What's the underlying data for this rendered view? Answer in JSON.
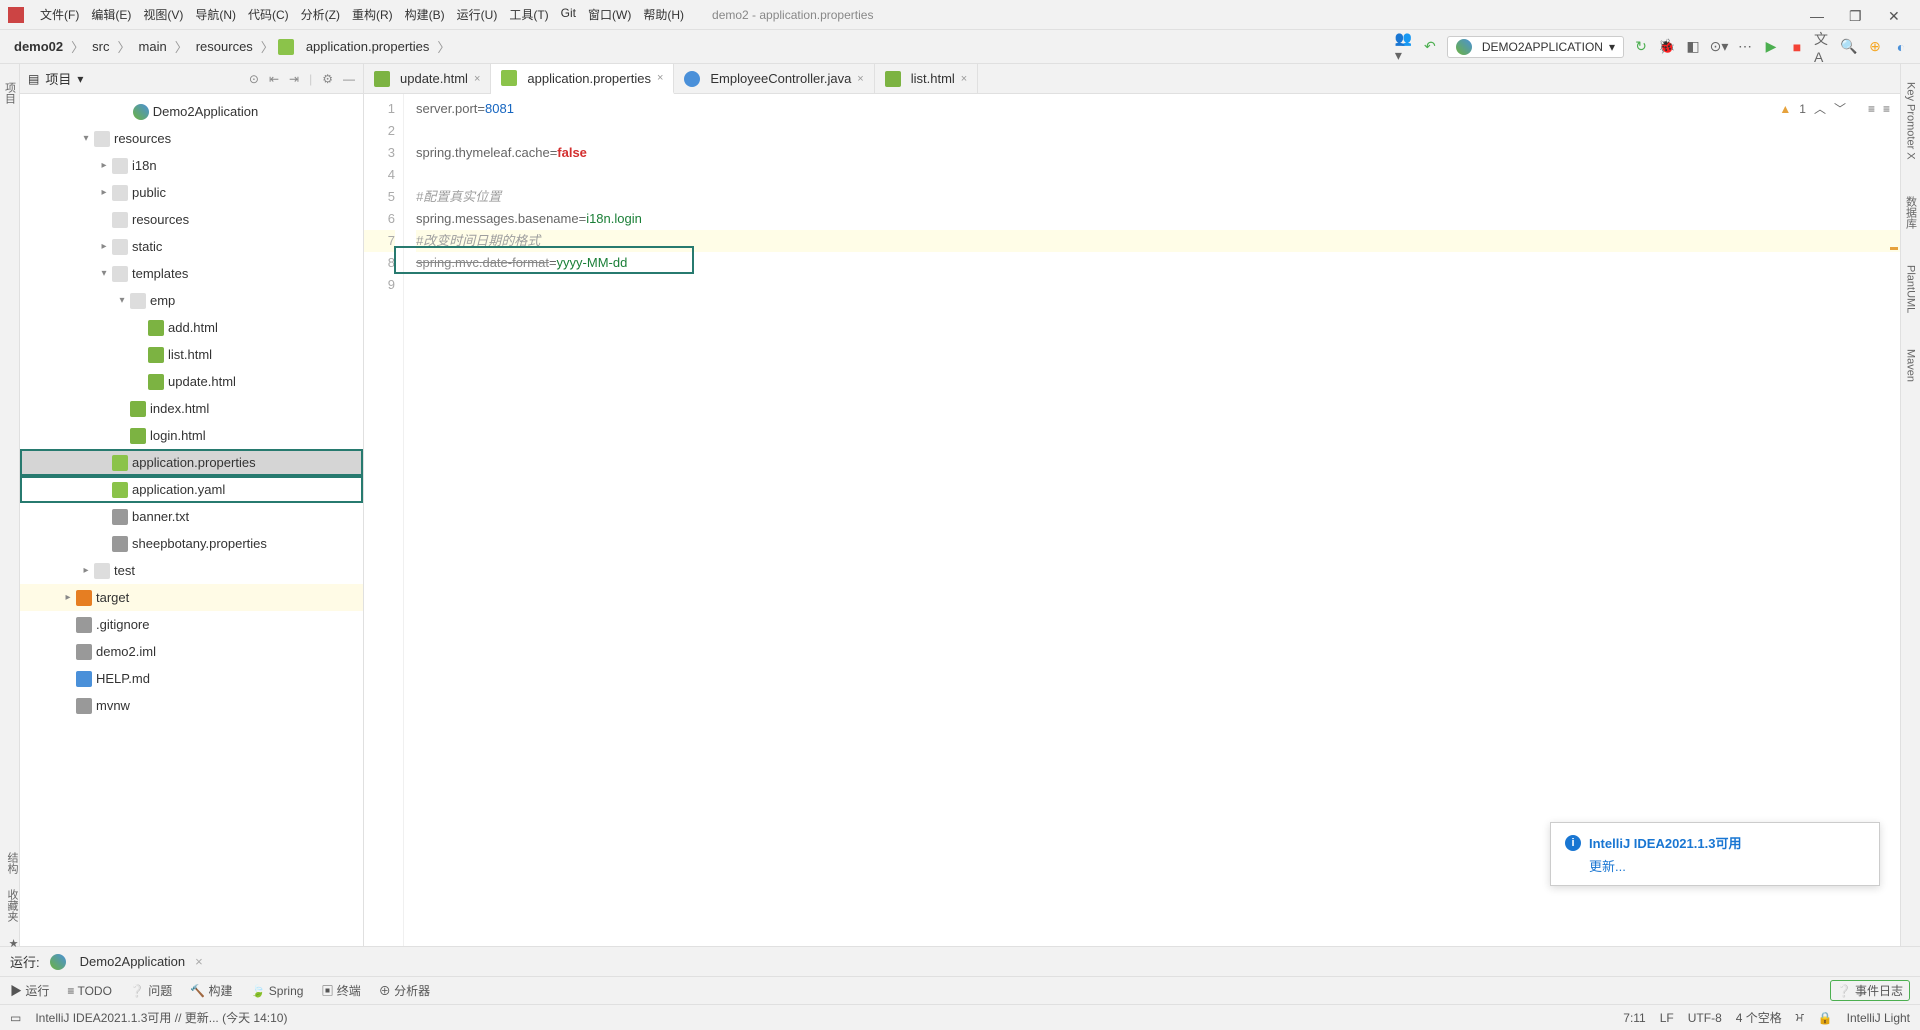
{
  "window": {
    "title": "demo2 - application.properties"
  },
  "menu": [
    "文件(F)",
    "编辑(E)",
    "视图(V)",
    "导航(N)",
    "代码(C)",
    "分析(Z)",
    "重构(R)",
    "构建(B)",
    "运行(U)",
    "工具(T)",
    "Git",
    "窗口(W)",
    "帮助(H)"
  ],
  "breadcrumbs": [
    "demo02",
    "src",
    "main",
    "resources",
    "application.properties"
  ],
  "runConfig": "DEMO2APPLICATION",
  "project": {
    "title": "项目",
    "root": "Demo2Application",
    "tree": [
      {
        "indent": 1,
        "arrow": "▾",
        "icon": "folder",
        "label": "resources"
      },
      {
        "indent": 2,
        "arrow": "▸",
        "icon": "folder",
        "label": "i18n"
      },
      {
        "indent": 2,
        "arrow": "▸",
        "icon": "folder",
        "label": "public"
      },
      {
        "indent": 2,
        "arrow": "",
        "icon": "folder",
        "label": "resources"
      },
      {
        "indent": 2,
        "arrow": "▸",
        "icon": "folder",
        "label": "static"
      },
      {
        "indent": 2,
        "arrow": "▾",
        "icon": "folder",
        "label": "templates"
      },
      {
        "indent": 3,
        "arrow": "▾",
        "icon": "folder",
        "label": "emp"
      },
      {
        "indent": 4,
        "arrow": "",
        "icon": "html",
        "label": "add.html"
      },
      {
        "indent": 4,
        "arrow": "",
        "icon": "html",
        "label": "list.html"
      },
      {
        "indent": 4,
        "arrow": "",
        "icon": "html",
        "label": "update.html"
      },
      {
        "indent": 3,
        "arrow": "",
        "icon": "html",
        "label": "index.html"
      },
      {
        "indent": 3,
        "arrow": "",
        "icon": "html",
        "label": "login.html"
      },
      {
        "indent": 2,
        "arrow": "",
        "icon": "props",
        "label": "application.properties",
        "selected": true,
        "hl": true
      },
      {
        "indent": 2,
        "arrow": "",
        "icon": "yaml",
        "label": "application.yaml",
        "hl": true
      },
      {
        "indent": 2,
        "arrow": "",
        "icon": "txt",
        "label": "banner.txt"
      },
      {
        "indent": 2,
        "arrow": "",
        "icon": "txt",
        "label": "sheepbotany.properties"
      },
      {
        "indent": 1,
        "arrow": "▸",
        "icon": "folder",
        "label": "test"
      },
      {
        "indent": 0,
        "arrow": "▸",
        "icon": "tgt-ico",
        "label": "target",
        "tgt": true
      },
      {
        "indent": 0,
        "arrow": "",
        "icon": "txt",
        "label": ".gitignore"
      },
      {
        "indent": 0,
        "arrow": "",
        "icon": "txt",
        "label": "demo2.iml"
      },
      {
        "indent": 0,
        "arrow": "",
        "icon": "md",
        "label": "HELP.md"
      },
      {
        "indent": 0,
        "arrow": "",
        "icon": "txt",
        "label": "mvnw"
      }
    ]
  },
  "tabs": [
    {
      "icon": "html",
      "label": "update.html"
    },
    {
      "icon": "props",
      "label": "application.properties",
      "active": true
    },
    {
      "icon": "java",
      "label": "EmployeeController.java"
    },
    {
      "icon": "html",
      "label": "list.html"
    }
  ],
  "code": {
    "lines": [
      [
        {
          "t": "server.port",
          "c": "k"
        },
        {
          "t": "=",
          "c": "eq"
        },
        {
          "t": "8081",
          "c": "num"
        }
      ],
      [],
      [
        {
          "t": "spring.thymeleaf.cache",
          "c": "k"
        },
        {
          "t": "=",
          "c": "eq"
        },
        {
          "t": "false",
          "c": "bool"
        }
      ],
      [],
      [
        {
          "t": "#配置真实位置",
          "c": "cmt"
        }
      ],
      [
        {
          "t": "spring.messages.basename",
          "c": "k"
        },
        {
          "t": "=",
          "c": "eq"
        },
        {
          "t": "i18n.login",
          "c": "v"
        }
      ],
      [
        {
          "t": "#改变时间日期的格式",
          "c": "cmt"
        }
      ],
      [
        {
          "t": "spring.mvc.date-format",
          "c": "strike"
        },
        {
          "t": "=",
          "c": "eq"
        },
        {
          "t": "yyyy-MM-dd",
          "c": "v"
        }
      ],
      []
    ],
    "hlLine": 7,
    "box": {
      "line": 8
    }
  },
  "warnings": {
    "count": "1"
  },
  "leftTabs": [
    "项目"
  ],
  "rightTabs": [
    "Key Promoter X",
    "数据库",
    "PlantUML",
    "Maven"
  ],
  "leftBottomTabs": [
    "结构",
    "收藏夹"
  ],
  "runPanel": {
    "label": "运行:",
    "app": "Demo2Application"
  },
  "bottomTools": [
    "▶ 运行",
    "≡ TODO",
    "❔ 问题",
    "🔨 构建",
    "🍃 Spring",
    "▣ 终端",
    "⊕ 分析器"
  ],
  "bottomRight": "❔ 事件日志",
  "status": {
    "left": "IntelliJ IDEA2021.1.3可用 // 更新... (今天 14:10)",
    "pos": "7:11",
    "sep": "LF",
    "enc": "UTF-8",
    "indent": "4 个空格",
    "theme": "IntelliJ Light"
  },
  "popup": {
    "title": "IntelliJ IDEA2021.1.3可用",
    "link": "更新..."
  }
}
